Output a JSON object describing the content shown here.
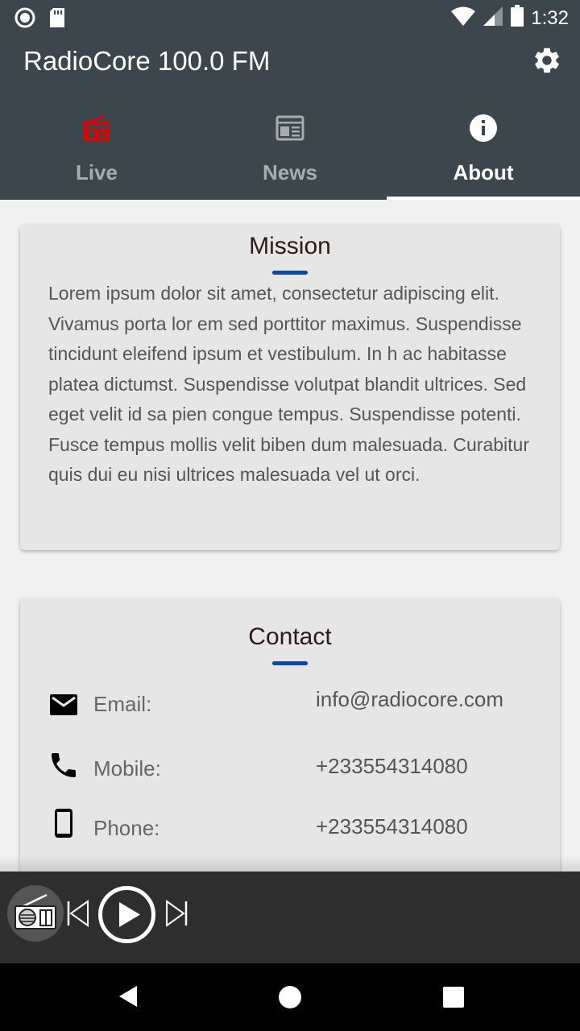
{
  "status_bar": {
    "time": "1:32"
  },
  "app": {
    "title": "RadioCore 100.0 FM"
  },
  "tabs": [
    {
      "label": "Live",
      "icon": "radio-icon"
    },
    {
      "label": "News",
      "icon": "newspaper-icon"
    },
    {
      "label": "About",
      "icon": "info-icon",
      "active": true
    }
  ],
  "mission": {
    "title": "Mission",
    "text": "Lorem ipsum dolor sit amet, consectetur adipiscing elit. Vivamus porta lor em sed porttitor maximus. Suspendisse tincidunt eleifend ipsum et vestibulum. In h ac habitasse platea dictumst. Suspendisse volutpat blandit ultrices. Sed eget velit id sa pien congue tempus. Suspendisse potenti. Fusce tempus mollis velit biben dum malesuada. Curabitur quis dui eu nisi ultrices malesuada vel ut orci."
  },
  "contact": {
    "title": "Contact",
    "rows": [
      {
        "icon": "email-icon",
        "label": "Email:",
        "value": "info@radiocore.com"
      },
      {
        "icon": "phone-icon",
        "label": "Mobile:",
        "value": "+233554314080"
      },
      {
        "icon": "smartphone-icon",
        "label": "Phone:",
        "value": "+233554314080"
      }
    ]
  },
  "colors": {
    "app_bar": "#3c474d",
    "live_icon": "#e00000",
    "accent_underline": "#0d47a1",
    "card": "#e6e6e6",
    "player": "#2e2e2e"
  }
}
